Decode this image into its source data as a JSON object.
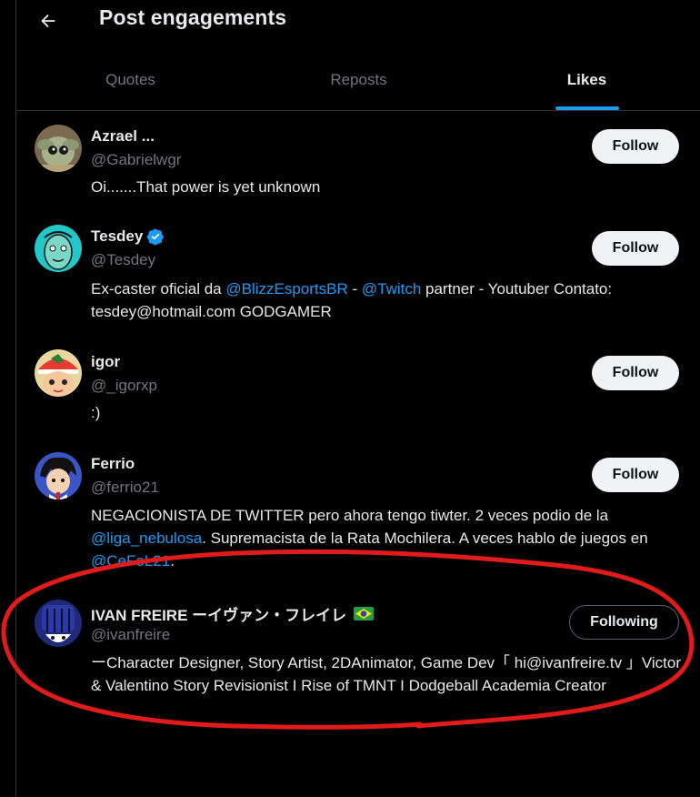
{
  "header": {
    "title": "Post engagements",
    "back_icon": "arrow-left-icon"
  },
  "tabs": [
    {
      "label": "Quotes",
      "active": false
    },
    {
      "label": "Reposts",
      "active": false
    },
    {
      "label": "Likes",
      "active": true
    }
  ],
  "colors": {
    "accent": "#1d9bf0",
    "background": "#000000",
    "muted": "#71767b",
    "annotation": "#e01b1b"
  },
  "users": [
    {
      "name": "Azrael ...",
      "handle": "@Gabrielwgr",
      "verified": false,
      "bio_parts": [
        {
          "text": "Oi.......That power is yet unknown",
          "link": false
        }
      ],
      "button": "Follow"
    },
    {
      "name": "Tesdey",
      "handle": "@Tesdey",
      "verified": true,
      "bio_parts": [
        {
          "text": "Ex-caster oficial da ",
          "link": false
        },
        {
          "text": "@BlizzEsportsBR",
          "link": true
        },
        {
          "text": " - ",
          "link": false
        },
        {
          "text": "@Twitch",
          "link": true
        },
        {
          "text": " partner - Youtuber Contato: tesdey@hotmail.com GODGAMER",
          "link": false
        }
      ],
      "button": "Follow"
    },
    {
      "name": "igor",
      "handle": "@_igorxp",
      "verified": false,
      "bio_parts": [
        {
          "text": ":)",
          "link": false
        }
      ],
      "button": "Follow"
    },
    {
      "name": "Ferrio",
      "handle": "@ferrio21",
      "verified": false,
      "bio_parts": [
        {
          "text": "NEGACIONISTA DE TWITTER pero ahora tengo tiwter. 2 veces podio de la ",
          "link": false
        },
        {
          "text": "@liga_nebulosa",
          "link": true
        },
        {
          "text": ". Supremacista de la Rata Mochilera. A veces hablo de juegos en ",
          "link": false
        },
        {
          "text": "@CeFeL21",
          "link": true
        },
        {
          "text": ".",
          "link": false
        }
      ],
      "button": "Follow"
    },
    {
      "name": "IVAN FREIRE ーイヴァン・フレイレ",
      "handle": "@ivanfreire",
      "verified": false,
      "flag": "brazil-flag-icon",
      "bio_parts": [
        {
          "text": "ーCharacter Designer, Story Artist, 2DAnimator, Game Dev「 hi@ivanfreire.tv 」Victor & Valentino Story Revisionist I Rise of TMNT I Dodgeball Academia Creator",
          "link": false
        }
      ],
      "button": "Following"
    }
  ]
}
